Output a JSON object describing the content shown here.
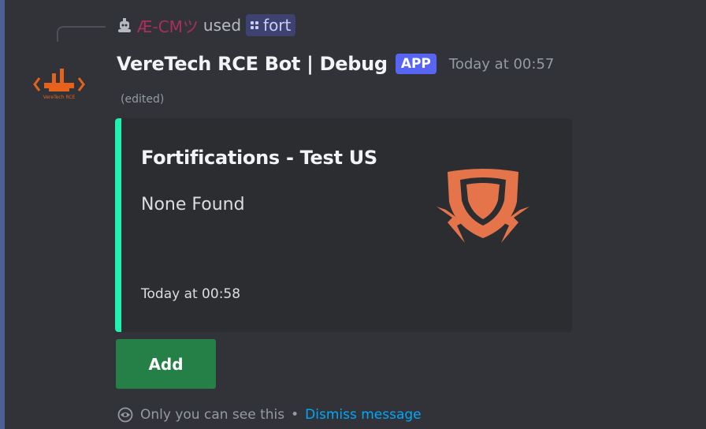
{
  "reply": {
    "user": "Æ-CMツ",
    "used_text": "used",
    "command": "fort",
    "avatar_icon": "robot-icon",
    "user_color": "#a8305a"
  },
  "message": {
    "author": "VereTech RCE Bot | Debug",
    "badge": "APP",
    "timestamp": "Today at 00:57",
    "edited": "(edited)",
    "avatar_icon": "veretech-logo",
    "avatar_caption": "VereTech RCE"
  },
  "embed": {
    "accent_color": "#1ff2b0",
    "title": "Fortifications - Test US",
    "description": "None Found",
    "footer": "Today at 00:58",
    "thumbnail_icon": "shield-lightning-icon",
    "thumbnail_color": "#e5744a"
  },
  "components": {
    "add_button": "Add",
    "add_button_color": "#248046"
  },
  "ephemeral": {
    "notice": "Only you can see this",
    "separator": "•",
    "dismiss": "Dismiss message",
    "icon": "eye-icon"
  }
}
